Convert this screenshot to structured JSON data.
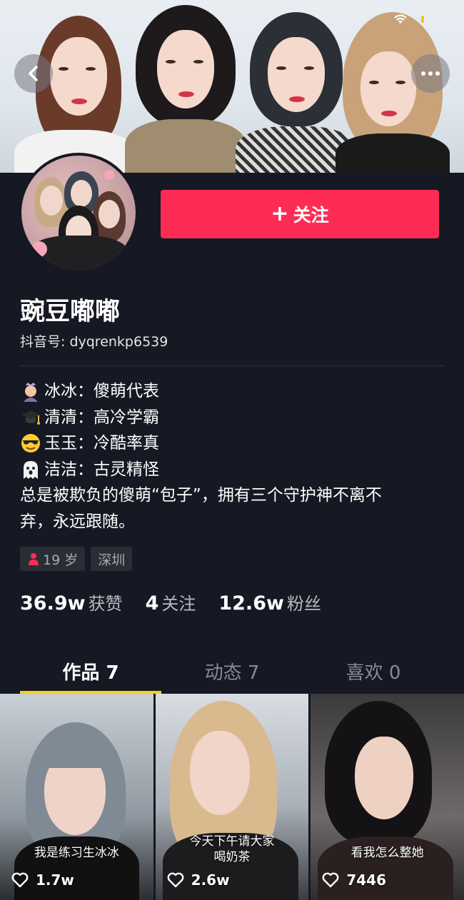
{
  "header": {
    "back_icon": "chevron-left-icon",
    "more_icon": "more-dots-icon"
  },
  "profile": {
    "follow_label": "关注",
    "follow_icon": "plus",
    "name": "豌豆嘟嘟",
    "douyin_id": "抖音号: dyqrenkp6539",
    "bio": [
      {
        "icon": "princess-emoji",
        "text": "冰冰：傻萌代表"
      },
      {
        "icon": "graduation-cap-emoji",
        "text": "清清：高冷学霸"
      },
      {
        "icon": "sunglasses-emoji",
        "text": "玉玉：冷酷率真"
      },
      {
        "icon": "ghost-emoji",
        "text": "洁洁：古灵精怪"
      }
    ],
    "bio_paragraph_1": "总是被欺负的傻萌“包子”，拥有三个守护神不离不",
    "bio_paragraph_2": "弃，永远跟随。",
    "tags": {
      "age": "19 岁",
      "city": "深圳"
    },
    "stats": {
      "likes_value": "36.9w",
      "likes_label": "获赞",
      "following_value": "4",
      "following_label": "关注",
      "followers_value": "12.6w",
      "followers_label": "粉丝"
    }
  },
  "tabs": [
    {
      "label": "作品 7",
      "active": true
    },
    {
      "label": "动态 7",
      "active": false
    },
    {
      "label": "喜欢 0",
      "active": false
    }
  ],
  "videos": [
    {
      "caption": "我是练习生冰冰",
      "likes": "1.7w"
    },
    {
      "caption_line1": "今天下午请大家",
      "caption_line2": "喝奶茶",
      "likes": "2.6w"
    },
    {
      "caption": "看我怎么整她",
      "likes": "7446"
    }
  ],
  "colors": {
    "background": "#161823",
    "follow_button": "#fe2c55",
    "tab_underline": "#face15"
  }
}
